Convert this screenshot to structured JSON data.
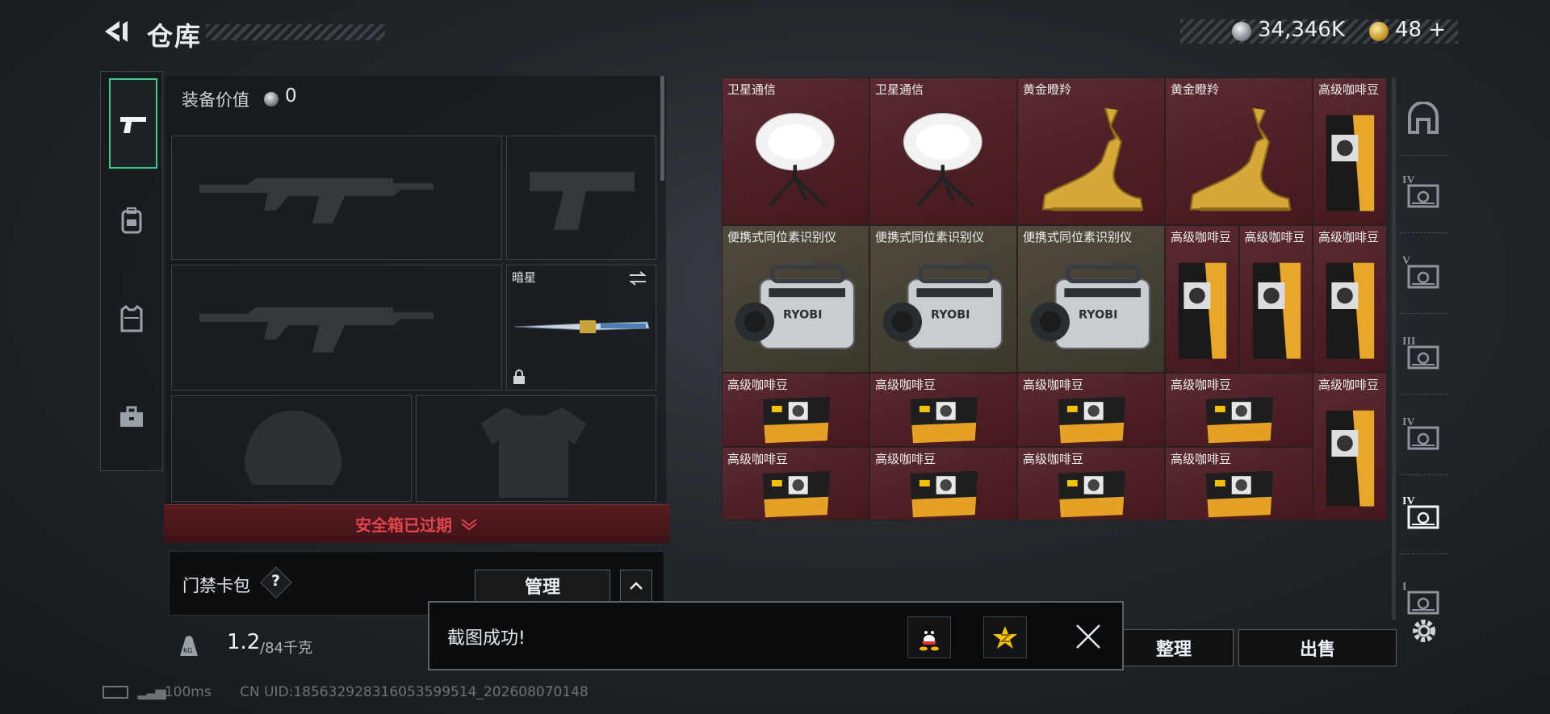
{
  "header": {
    "title": "仓库",
    "currencies": [
      {
        "name": "coin-icon",
        "value": "34,346K"
      },
      {
        "name": "premium-coin-icon",
        "value": "48 +"
      }
    ]
  },
  "left_nav": [
    {
      "icon": "pistol-icon",
      "active": true
    },
    {
      "icon": "backpack-icon",
      "active": false
    },
    {
      "icon": "vest-icon",
      "active": false
    },
    {
      "icon": "toolbox-icon",
      "active": false
    }
  ],
  "equipment": {
    "value_label": "装备价值",
    "value": "0",
    "melee_name": "暗星"
  },
  "safe_box": {
    "warning": "安全箱已过期"
  },
  "keycard": {
    "label": "门禁卡包",
    "help": "?",
    "manage": "管理"
  },
  "weight": {
    "current": "1.2",
    "max": "/84千克",
    "badge": "KG"
  },
  "grid": {
    "cells": [
      {
        "label": "卫星通信",
        "item": "satellite-dish"
      },
      {
        "label": "卫星通信",
        "item": "satellite-dish"
      },
      {
        "label": "黄金瞪羚",
        "item": "golden-gazelle"
      },
      {
        "label": "黄金瞪羚",
        "item": "golden-gazelle"
      },
      {
        "label": "高级咖啡豆",
        "item": "coffee-bag"
      },
      {
        "label": "便携式同位素识别仪",
        "item": "isotope-device"
      },
      {
        "label": "便携式同位素识别仪",
        "item": "isotope-device"
      },
      {
        "label": "便携式同位素识别仪",
        "item": "isotope-device"
      },
      {
        "label": "高级咖啡豆",
        "item": "coffee-bag"
      },
      {
        "label": "高级咖啡豆",
        "item": "coffee-bag"
      },
      {
        "label": "高级咖啡豆",
        "item": "coffee-bag"
      },
      {
        "label": "高级咖啡豆",
        "item": "coffee-pack"
      },
      {
        "label": "高级咖啡豆",
        "item": "coffee-pack"
      },
      {
        "label": "高级咖啡豆",
        "item": "coffee-pack"
      },
      {
        "label": "高级咖啡豆",
        "item": "coffee-pack"
      },
      {
        "label": "高级咖啡豆",
        "item": "coffee-bag"
      },
      {
        "label": "高级咖啡豆",
        "item": "coffee-pack"
      },
      {
        "label": "高级咖啡豆",
        "item": "coffee-pack"
      },
      {
        "label": "高级咖啡豆",
        "item": "coffee-pack"
      },
      {
        "label": "高级咖啡豆",
        "item": "coffee-pack"
      }
    ]
  },
  "right_nav": [
    {
      "icon": "safe-icon"
    },
    {
      "icon": "tier-iv-case-icon",
      "tier": "IV"
    },
    {
      "icon": "tier-v-case-icon",
      "tier": "V"
    },
    {
      "icon": "tier-iii-case-icon",
      "tier": "III"
    },
    {
      "icon": "tier-iv-pouch-icon",
      "tier": "IV"
    },
    {
      "icon": "tier-iv-pouch-active-icon",
      "tier": "IV"
    },
    {
      "icon": "tier-i-case-icon",
      "tier": "I"
    }
  ],
  "actions": {
    "sort": "整理",
    "sell": "出售"
  },
  "toast": {
    "message": "截图成功!"
  },
  "status": {
    "ping": "100ms",
    "uid": "CN UID:18563292831605359951​4_202608070148"
  }
}
